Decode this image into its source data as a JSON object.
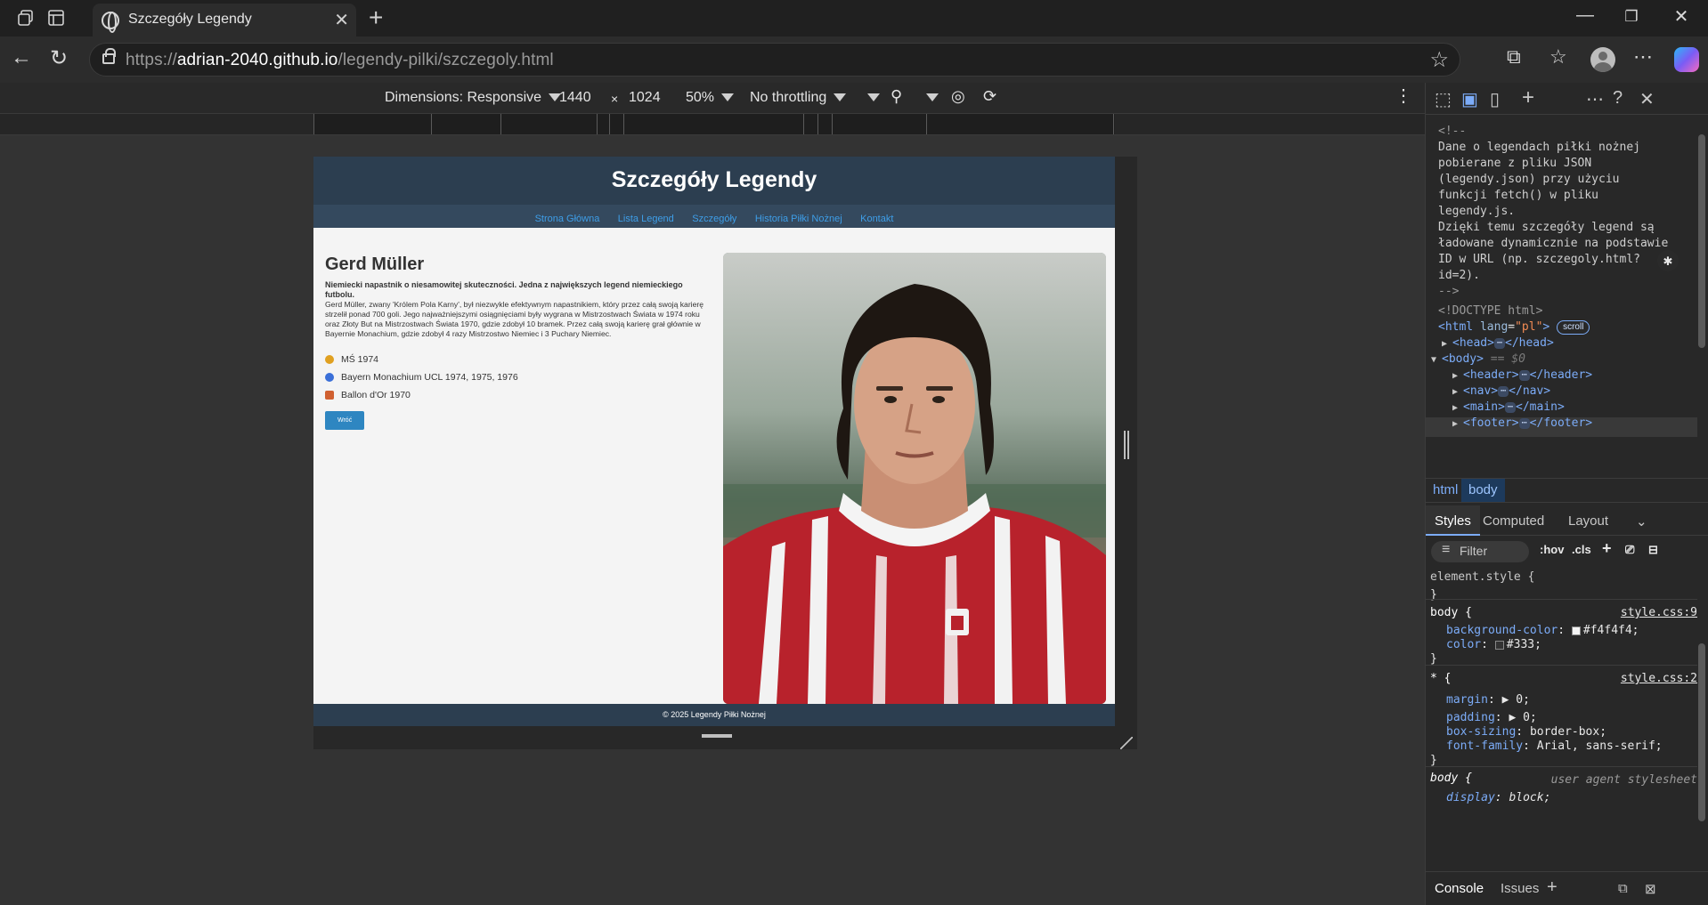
{
  "browser": {
    "tab_title": "Szczegóły Legendy",
    "url_scheme": "https://",
    "url_host": "adrian-2040.github.io",
    "url_path": "/legendy-pilki/szczegoly.html"
  },
  "device_toolbar": {
    "dimensions_label": "Dimensions: Responsive",
    "width": "1440",
    "times": "×",
    "height": "1024",
    "zoom": "50%",
    "throttling": "No throttling"
  },
  "page": {
    "header_title": "Szczegóły Legendy",
    "nav": [
      "Strona Główna",
      "Lista Legend",
      "Szczegóły",
      "Historia Piłki Nożnej",
      "Kontakt"
    ],
    "name": "Gerd Müller",
    "lead": "Niemiecki napastnik o niesamowitej skuteczności. Jedna z największych legend niemieckiego futbolu.",
    "description": "Gerd Müller, zwany 'Królem Pola Karny', był niezwykle efektywnym napastnikiem, który przez całą swoją karierę strzelił ponad 700 goli. Jego najważniejszymi osiągnięciami były wygrana w Mistrzostwach Świata w 1974 roku oraz Złoty But na Mistrzostwach Świata 1970, gdzie zdobył 10 bramek. Przez całą swoją karierę grał głównie w Bayernie Monachium, gdzie zdobył 4 razy Mistrzostwo Niemiec i 3 Puchary Niemiec.",
    "trophies": [
      {
        "icon": "medal-icon",
        "color": "#e0a020",
        "label": "MŚ 1974"
      },
      {
        "icon": "club-crest-icon",
        "color": "#3a6fd8",
        "label": "Bayern Monachium UCL 1974, 1975, 1976"
      },
      {
        "icon": "ballon-dor-icon",
        "color": "#d06030",
        "label": "Ballon d'Or 1970"
      }
    ],
    "back_button": "Wróć",
    "footer": "© 2025 Legendy Piłki Nożnej"
  },
  "devtools": {
    "comment_lines": [
      "<!--",
      "Dane o legendach piłki nożnej",
      "pobierane z pliku JSON",
      "(legendy.json) przy użyciu",
      "funkcji fetch() w pliku",
      "legendy.js.",
      "Dzięki temu szczegóły legend są",
      "ładowane dynamicznie na podstawie",
      "ID w URL (np. szczegoly.html?",
      "id=2).",
      "-->"
    ],
    "doctype": "<!DOCTYPE html>",
    "html_open": "<html",
    "html_lang_attr": "lang",
    "html_lang_val": "\"pl\"",
    "scroll_badge": "scroll",
    "nodes": [
      "<head>",
      "</head>",
      "<body>",
      "== $0",
      "<header>",
      "</header>",
      "<nav>",
      "</nav>",
      "<main>",
      "</main>",
      "<footer>",
      "</footer>"
    ],
    "breadcrumbs": [
      "html",
      "body"
    ],
    "style_tabs": [
      "Styles",
      "Computed",
      "Layout"
    ],
    "filter_placeholder": "Filter",
    "hov": ":hov",
    "cls": ".cls",
    "rules": {
      "element_style": "element.style {",
      "close": "}",
      "body_sel": "body {",
      "body_src": "style.css:9",
      "bg_prop": "background-color",
      "bg_val": "#f4f4f4;",
      "color_prop": "color",
      "color_val": "#333;",
      "star_sel": "* {",
      "star_src": "style.css:2",
      "margin_prop": "margin",
      "margin_val": "0;",
      "padding_prop": "padding",
      "padding_val": "0;",
      "boxsizing_prop": "box-sizing",
      "boxsizing_val": "border-box;",
      "font_prop": "font-family",
      "font_val": "Arial, sans-serif;",
      "ua_sel": "body {",
      "ua_src": "user agent stylesheet",
      "display_prop": "display",
      "display_val": "block;"
    },
    "bottom_tabs": [
      "Console",
      "Issues"
    ]
  }
}
